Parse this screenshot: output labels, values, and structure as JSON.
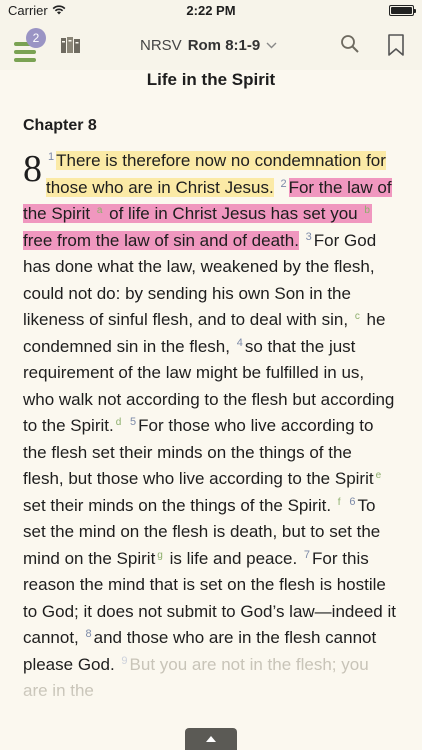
{
  "status": {
    "carrier": "Carrier",
    "time": "2:22 PM"
  },
  "toolbar": {
    "badge_count": "2",
    "translation": "NRSV",
    "reference": "Rom 8:1-9",
    "icons": [
      "menu-icon",
      "library-icon",
      "chevron-down-icon",
      "search-icon",
      "bookmark-icon"
    ]
  },
  "colors": {
    "accent_green": "#7aa253",
    "badge_purple": "#9a94c4",
    "highlight_yellow": "#fbeaa6",
    "highlight_pink": "#f097bf",
    "page_background": "#fbf8ef"
  },
  "passage": {
    "heading": "Life in the Spirit",
    "chapter_label": "Chapter 8",
    "chapter_number": "8",
    "segments": {
      "v1_num": "1",
      "v1_text": "There is therefore now no condemnation for those who are in Christ Jesus.",
      "v2_num": "2",
      "v2_a": "For the law of the Spirit",
      "fn_a": "a",
      "v2_b": "of life in Christ Jesus has set you",
      "fn_b": "b",
      "v2_c": "free from the law of sin and of death.",
      "v3_num": "3",
      "v3_a": "For God has done what the law, weak­ened by the flesh, could not do: by sending his own Son in the likeness of sinful flesh, and to deal with sin,",
      "fn_c": "c",
      "v3_b": "he condemned sin in the flesh,",
      "v4_num": "4",
      "v4_text": "so that the just requirement of the law might be fulfilled in us, who walk not accord­ing to the flesh but according to the Spirit.",
      "fn_d": "d",
      "v5_num": "5",
      "v5_a": "For those who live according to the flesh set their minds on the things of the flesh, but those who live according to the Spirit",
      "fn_e": "e",
      "v5_b": "set their minds on the things of the Spirit.",
      "fn_f": "f",
      "v6_num": "6",
      "v6_a": "To set the mind on the flesh is death, but to set the mind on the Spirit",
      "fn_g": "g",
      "v6_b": "is life and peace.",
      "v7_num": "7",
      "v7_text": "For this reason the mind that is set on the flesh is hos­tile to God; it does not submit to God’s law—indeed it cannot,",
      "v8_num": "8",
      "v8_text": "and those who are in the flesh cannot please God.",
      "v9_num": "9",
      "v9_text": "But you are not in the flesh; you are in the"
    }
  }
}
